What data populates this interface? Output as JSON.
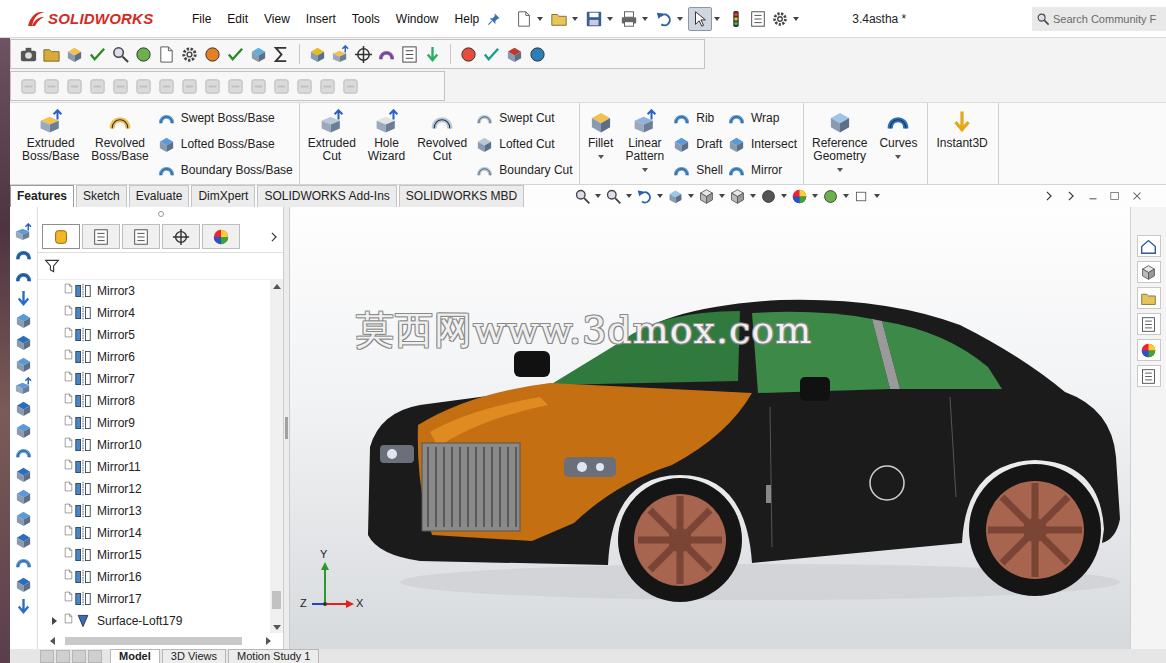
{
  "app": {
    "logo": "SOLIDWORKS"
  },
  "menu": [
    "File",
    "Edit",
    "View",
    "Insert",
    "Tools",
    "Window",
    "Help"
  ],
  "select_tool": {
    "selected": true
  },
  "document_title": "3.4astha *",
  "search": {
    "placeholder": "Search Community F"
  },
  "command_groups": [
    {
      "large": [
        "Extruded Boss/Base",
        "Revolved Boss/Base"
      ],
      "columns": [
        [
          "Swept Boss/Base",
          "Lofted Boss/Base",
          "Boundary Boss/Base"
        ]
      ]
    },
    {
      "large": [
        "Extruded Cut",
        "Hole Wizard",
        "Revolved Cut"
      ],
      "columns": [
        [
          "Swept Cut",
          "Lofted Cut",
          "Boundary Cut"
        ]
      ]
    },
    {
      "large": [
        "Fillet",
        "Linear Pattern"
      ],
      "columns": [
        [
          "Rib",
          "Draft",
          "Shell"
        ],
        [
          "Wrap",
          "Intersect",
          "Mirror"
        ]
      ]
    },
    {
      "large": [
        "Reference Geometry",
        "Curves"
      ],
      "columns": []
    },
    {
      "large": [
        "Instant3D"
      ],
      "columns": []
    }
  ],
  "command_tabs": [
    {
      "label": "Features",
      "selected": true
    },
    {
      "label": "Sketch",
      "selected": false
    },
    {
      "label": "Evaluate",
      "selected": false
    },
    {
      "label": "DimXpert",
      "selected": false
    },
    {
      "label": "SOLIDWORKS Add-Ins",
      "selected": false
    },
    {
      "label": "SOLIDWORKS MBD",
      "selected": false
    }
  ],
  "panel_tabs": [
    {
      "selected": true
    },
    {
      "selected": false
    },
    {
      "selected": false
    },
    {
      "selected": false
    },
    {
      "selected": false
    }
  ],
  "tree": {
    "items": [
      {
        "label": "Mirror3",
        "kind": "mirror",
        "expandable": false,
        "expanded": false
      },
      {
        "label": "Mirror4",
        "kind": "mirror",
        "expandable": false,
        "expanded": false
      },
      {
        "label": "Mirror5",
        "kind": "mirror",
        "expandable": false,
        "expanded": false
      },
      {
        "label": "Mirror6",
        "kind": "mirror",
        "expandable": false,
        "expanded": false
      },
      {
        "label": "Mirror7",
        "kind": "mirror",
        "expandable": false,
        "expanded": false
      },
      {
        "label": "Mirror8",
        "kind": "mirror",
        "expandable": false,
        "expanded": false
      },
      {
        "label": "Mirror9",
        "kind": "mirror",
        "expandable": false,
        "expanded": false
      },
      {
        "label": "Mirror10",
        "kind": "mirror",
        "expandable": false,
        "expanded": false
      },
      {
        "label": "Mirror11",
        "kind": "mirror",
        "expandable": false,
        "expanded": false
      },
      {
        "label": "Mirror12",
        "kind": "mirror",
        "expandable": false,
        "expanded": false
      },
      {
        "label": "Mirror13",
        "kind": "mirror",
        "expandable": false,
        "expanded": false
      },
      {
        "label": "Mirror14",
        "kind": "mirror",
        "expandable": false,
        "expanded": false
      },
      {
        "label": "Mirror15",
        "kind": "mirror",
        "expandable": false,
        "expanded": false
      },
      {
        "label": "Mirror16",
        "kind": "mirror",
        "expandable": false,
        "expanded": false
      },
      {
        "label": "Mirror17",
        "kind": "mirror",
        "expandable": false,
        "expanded": false
      },
      {
        "label": "Surface-Loft179",
        "kind": "loft",
        "expandable": true,
        "expanded": false
      }
    ],
    "scroll": {
      "level": 0.96
    }
  },
  "graphics": {
    "watermark": "莫西网www.3dmox.com",
    "triad": {
      "x": "X",
      "y": "Y",
      "z": "Z"
    }
  },
  "bottom_tabs": [
    {
      "label": "Model",
      "selected": true
    },
    {
      "label": "3D Views",
      "selected": false
    },
    {
      "label": "Motion Study 1",
      "selected": false
    }
  ]
}
